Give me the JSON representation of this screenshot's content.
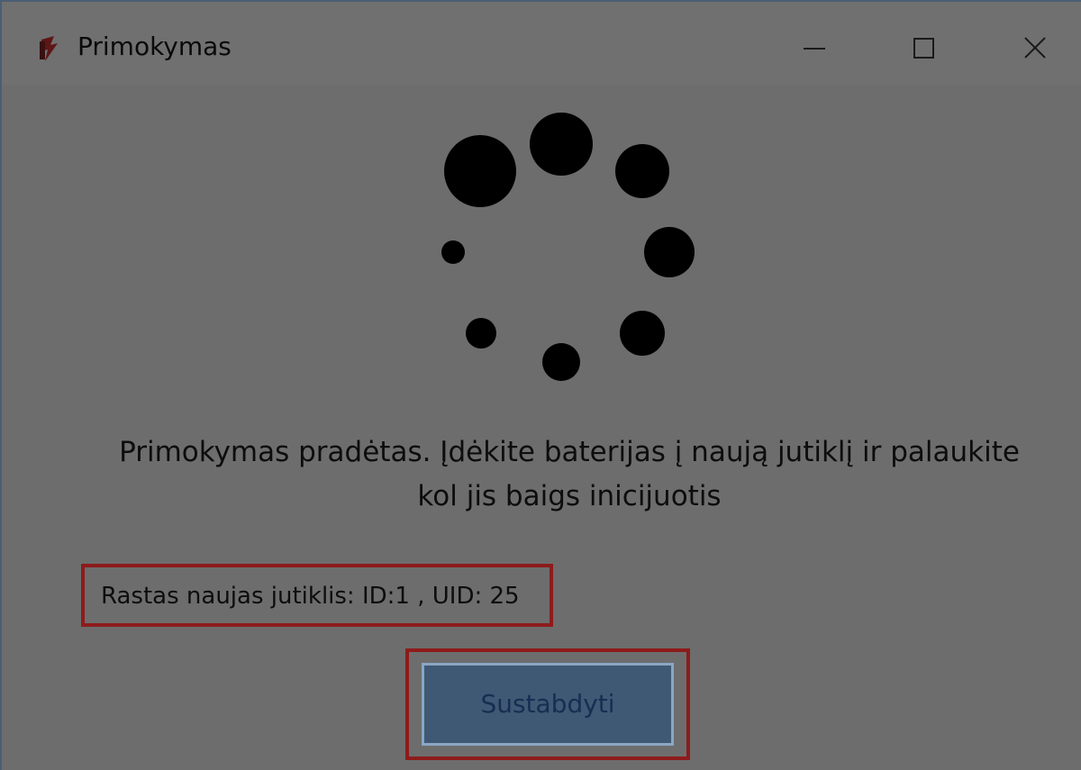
{
  "window": {
    "title": "Primokymas",
    "controls": {
      "minimize_icon": "minimize-icon",
      "maximize_icon": "maximize-icon",
      "close_icon": "close-icon"
    }
  },
  "main": {
    "message_line1": "Primokymas pradėtas. Įdėkite baterijas į naują jutiklį ir palaukite",
    "message_line2": "kol jis baigs inicijuotis",
    "status_text": "Rastas naujas jutiklis: ID:1 , UID: 25",
    "stop_button_label": "Sustabdyti"
  },
  "colors": {
    "background": "#6d6d6d",
    "highlight_border": "#8e1b1b",
    "button_fill": "#3f5874",
    "button_text": "#172e52"
  }
}
